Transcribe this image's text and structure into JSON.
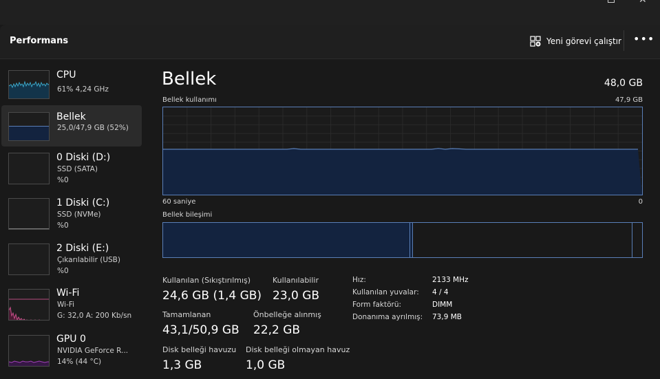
{
  "header": {
    "title": "Performans",
    "run_task_label": "Yeni görevi çalıştır",
    "more_label": "•••"
  },
  "sidebar": {
    "items": [
      {
        "name": "CPU",
        "sub1": "61% 4,24 GHz",
        "sub2": ""
      },
      {
        "name": "Bellek",
        "sub1": "25,0/47,9 GB (52%)",
        "sub2": ""
      },
      {
        "name": "0 Diski (D:)",
        "sub1": "SSD (SATA)",
        "sub2": "%0"
      },
      {
        "name": "1 Diski (C:)",
        "sub1": "SSD (NVMe)",
        "sub2": "%0"
      },
      {
        "name": "2 Diski (E:)",
        "sub1": "Çıkarılabilir (USB)",
        "sub2": "%0"
      },
      {
        "name": "Wi-Fi",
        "sub1": "Wi-Fi",
        "sub2": "G: 32,0 A: 200 Kb/sn"
      },
      {
        "name": "GPU 0",
        "sub1": "NVIDIA GeForce R...",
        "sub2": "14% (44 °C)"
      }
    ]
  },
  "main": {
    "title": "Bellek",
    "total": "48,0 GB",
    "usage_label": "Bellek kullanımı",
    "usage_max": "47,9 GB",
    "time_left": "60 saniye",
    "time_right": "0",
    "composition_label": "Bellek bileşimi",
    "usage_fraction": 0.52
  },
  "stats": {
    "in_use_label": "Kullanılan (Sıkıştırılmış)",
    "in_use_value": "24,6 GB (1,4 GB)",
    "available_label": "Kullanılabilir",
    "available_value": "23,0 GB",
    "committed_label": "Tamamlanan",
    "committed_value": "43,1/50,9 GB",
    "cached_label": "Önbelleğe alınmış",
    "cached_value": "22,2 GB",
    "paged_label": "Disk belleği havuzu",
    "paged_value": "1,3 GB",
    "nonpaged_label": "Disk belleği olmayan havuz",
    "nonpaged_value": "1,0 GB"
  },
  "specs": [
    {
      "key": "Hız:",
      "value": "2133 MHz"
    },
    {
      "key": "Kullanılan yuvalar:",
      "value": "4 / 4"
    },
    {
      "key": "Form faktörü:",
      "value": "DIMM"
    },
    {
      "key": "Donanıma ayrılmış:",
      "value": "73,9 MB"
    }
  ],
  "colors": {
    "memory_accent": "#5a7fb8",
    "memory_fill": "#13233f",
    "cpu_line": "#3aa6c9",
    "wifi_line": "#c94f8a",
    "gpu_line": "#a13fb8"
  }
}
